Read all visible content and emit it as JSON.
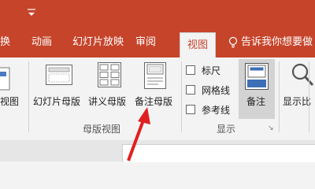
{
  "titlebar": {
    "dropdown_glyph": "⇥"
  },
  "tabs": [
    {
      "label": "换"
    },
    {
      "label": "动画"
    },
    {
      "label": "幻灯片放映"
    },
    {
      "label": "审阅"
    },
    {
      "label": "视图"
    }
  ],
  "tell_me": {
    "text": "告诉我你想要做",
    "icon": "lightbulb-icon"
  },
  "ribbon": {
    "left_cut_label": "视图",
    "master_views": {
      "group_label": "母版视图",
      "buttons": [
        {
          "label": "幻灯片母版"
        },
        {
          "label": "讲义母版"
        },
        {
          "label": "备注母版"
        }
      ]
    },
    "show": {
      "group_label": "显示",
      "checkboxes": [
        {
          "label": "标尺"
        },
        {
          "label": "网格线"
        },
        {
          "label": "参考线"
        }
      ]
    },
    "notes_button": {
      "label": "备注"
    },
    "zoom_cut_label": "显示比",
    "expand_glyph": "↘"
  },
  "colors": {
    "accent": "#c6442a",
    "arrow": "#e02020"
  }
}
